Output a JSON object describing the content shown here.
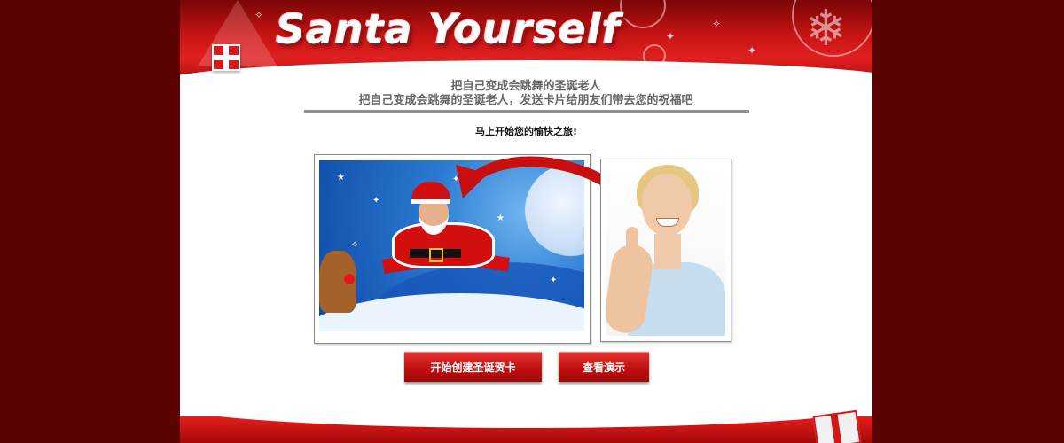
{
  "header": {
    "logo_text": "Santa Yourself"
  },
  "intro": {
    "line1": "把自己变成会跳舞的圣诞老人",
    "line2": "把自己变成会跳舞的圣诞老人，发送卡片给朋友们带去您的祝福吧"
  },
  "cta_text": "马上开始您的愉快之旅!",
  "images": {
    "left": "santa-scene-image",
    "right": "woman-photo-image"
  },
  "buttons": {
    "create_label": "开始创建圣诞贺卡",
    "demo_label": "查看演示"
  },
  "colors": {
    "background": "#5a0303",
    "brand_red": "#c81414",
    "button_red": "#c01010"
  }
}
